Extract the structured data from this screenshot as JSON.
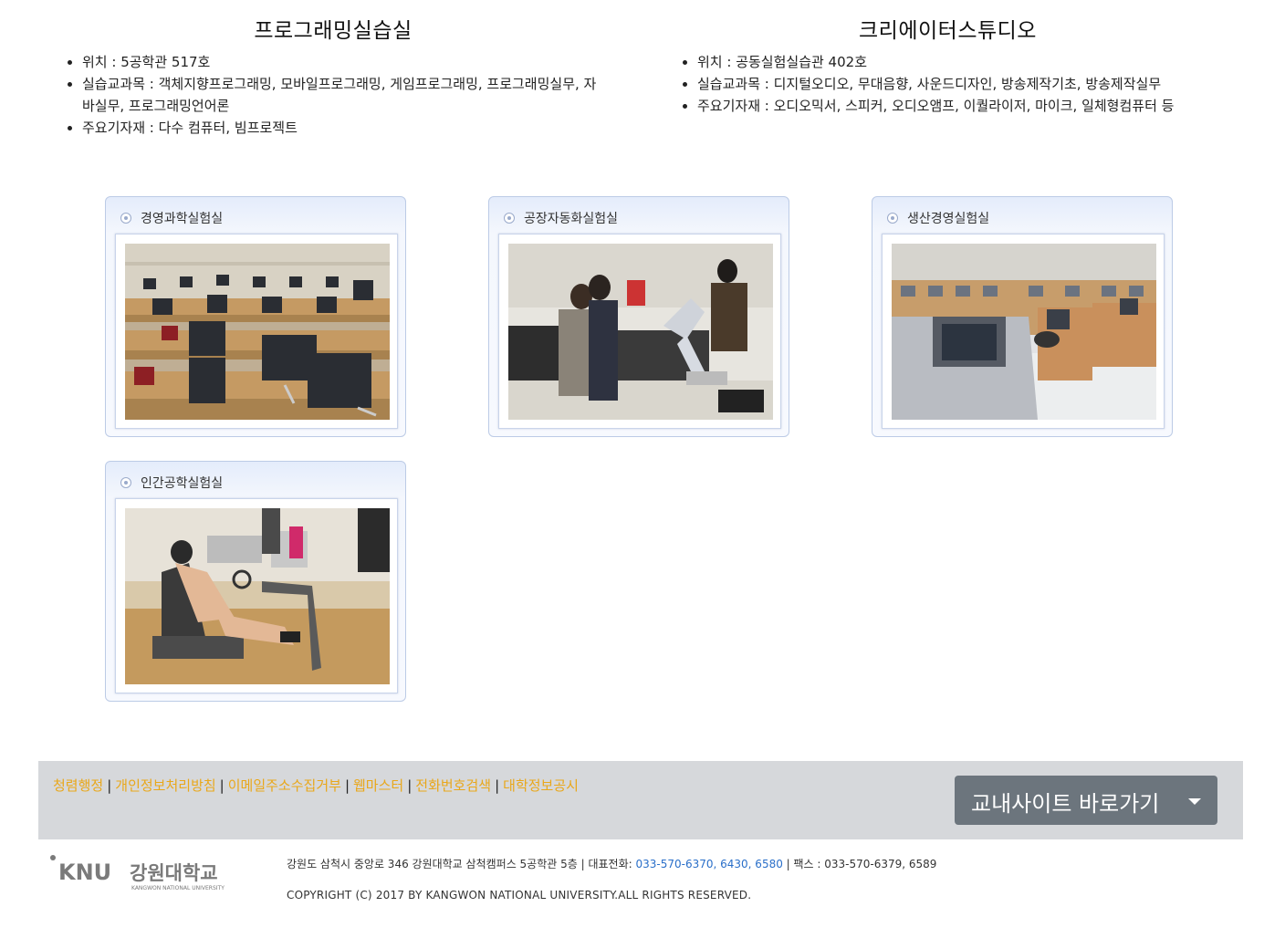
{
  "labs_top": [
    {
      "title": "프로그래밍실습실",
      "items": [
        "위치 : 5공학관 517호",
        "실습교과목 : 객체지향프로그래밍, 모바일프로그래밍, 게임프로그래밍, 프로그래밍실무, 자바실무, 프로그래밍언어론",
        "주요기자재 : 다수 컴퓨터, 빔프로젝트"
      ]
    },
    {
      "title": "크리에이터스튜디오",
      "items": [
        "위치 : 공동실험실습관 402호",
        "실습교과목 : 디지털오디오, 무대음향, 사운드디자인, 방송제작기초, 방송제작실무",
        "주요기자재 : 오디오믹서, 스피커, 오디오앰프, 이퀄라이저, 마이크, 일체형컴퓨터 등"
      ]
    }
  ],
  "lab_cards": [
    {
      "title": "경영과학실험실",
      "icon": "radio-bullet-icon",
      "photo": "computer-lab-photo"
    },
    {
      "title": "공장자동화실험실",
      "icon": "radio-bullet-icon",
      "photo": "robot-arm-lab-photo"
    },
    {
      "title": "생산경영실험실",
      "icon": "radio-bullet-icon",
      "photo": "lecture-console-lab-photo"
    },
    {
      "title": "인간공학실험실",
      "icon": "radio-bullet-icon",
      "photo": "driving-simulator-lab-photo"
    }
  ],
  "footer": {
    "links": [
      "청렴행정",
      "개인정보처리방침",
      "이메일주소수집거부",
      "웹마스터",
      "전화번호검색",
      "대학정보공시"
    ],
    "separator": "|",
    "site_button": "교내사이트 바로가기",
    "logo_mark": "KNU",
    "logo_text": "강원대학교",
    "logo_sub": "KANGWON NATIONAL UNIVERSITY",
    "address_prefix": "강원도 삼척시 중앙로 346 강원대학교 삼척캠퍼스 5공학관 5층 | 대표전화: ",
    "phones": "033-570-6370, 6430, 6580",
    "fax": " | 팩스 : 033-570-6379, 6589",
    "copyright": "COPYRIGHT (C) 2017 BY KANGWON NATIONAL UNIVERSITY.ALL RIGHTS RESERVED."
  },
  "colors": {
    "link": "#e9a71a",
    "phone": "#2a6fc9",
    "footer_bg": "#d6d8db",
    "button_bg": "#6c757d"
  }
}
